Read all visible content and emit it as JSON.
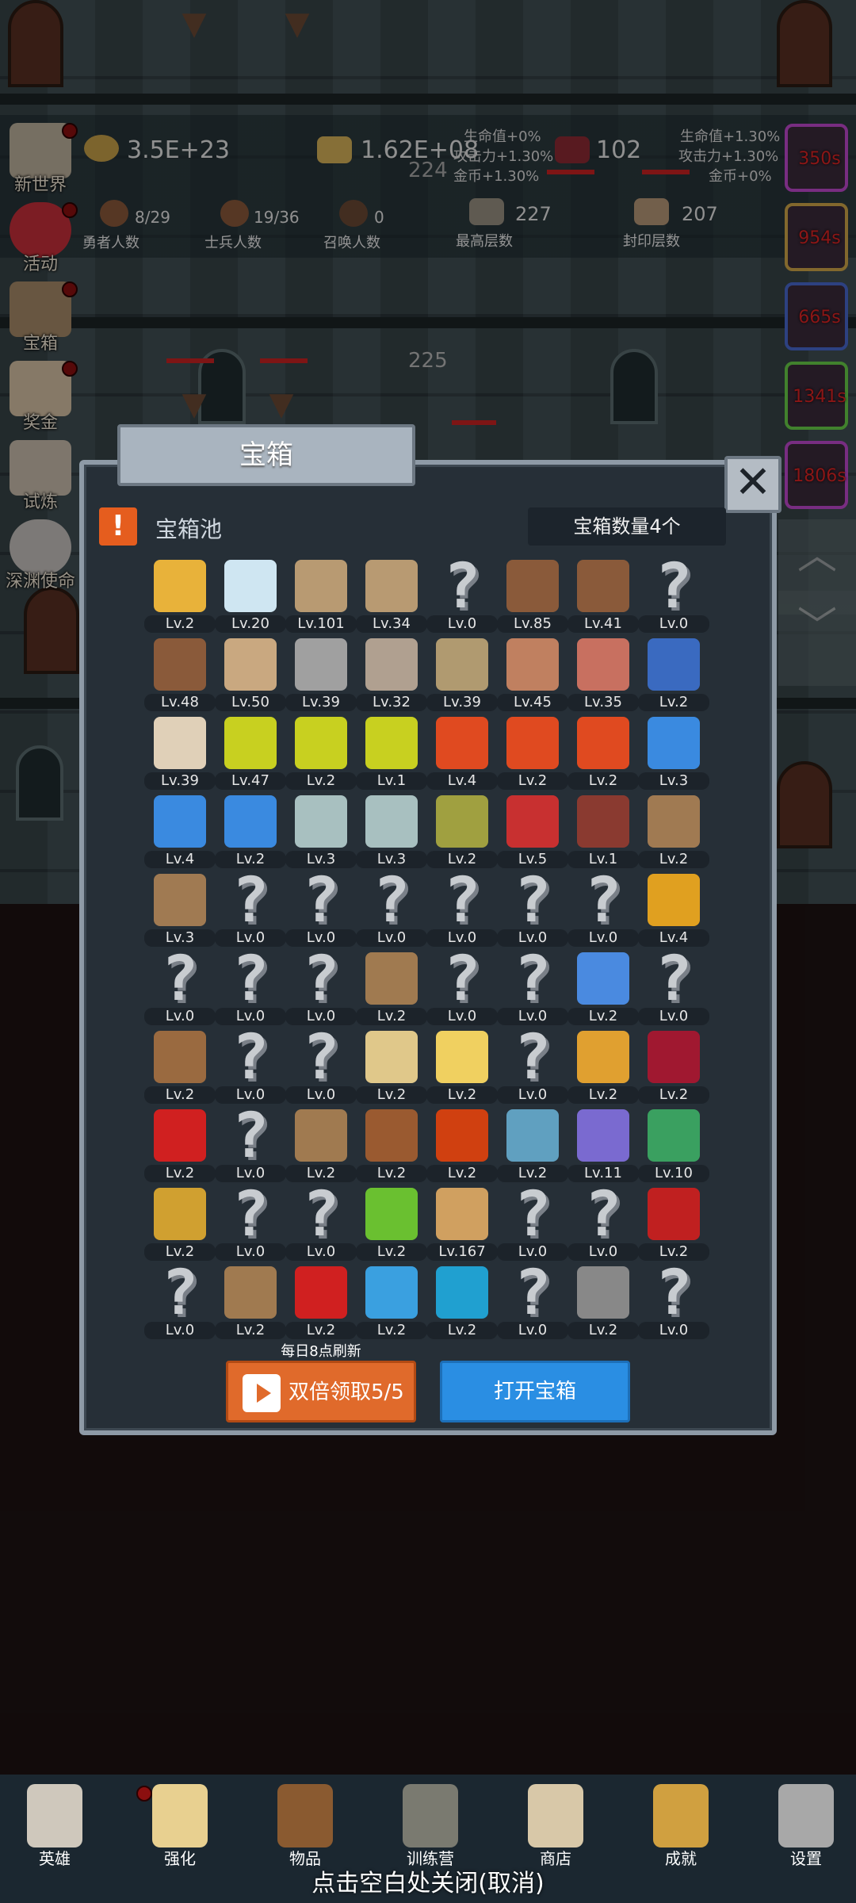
{
  "colors": {
    "accent_orange": "#e06a2b",
    "accent_blue": "#2a8ee3",
    "panel": "#262f37",
    "timer_red": "#e12424"
  },
  "top_stats": {
    "gold": "3.5E+23",
    "bars": "1.62E+08",
    "meat": "102",
    "damage_text": "224",
    "bonus_left": [
      "生命值+0%",
      "攻击力+1.30%",
      "金币+1.30%"
    ],
    "bonus_right": [
      "生命值+1.30%",
      "攻击力+1.30%",
      "金币+0%"
    ],
    "heroes": {
      "value": "8/29",
      "label": "勇者人数"
    },
    "soldiers": {
      "value": "19/36",
      "label": "士兵人数"
    },
    "summons": {
      "value": "0",
      "label": "召唤人数"
    },
    "max_floor": {
      "value": "227",
      "label": "最高层数"
    },
    "seal_floor": {
      "value": "207",
      "label": "封印层数"
    },
    "floor_number": "225"
  },
  "side_menu": [
    {
      "label": "新世界",
      "icon": "castle-icon"
    },
    {
      "label": "活动",
      "icon": "heart-icon"
    },
    {
      "label": "宝箱",
      "icon": "chest-icon"
    },
    {
      "label": "奖金",
      "icon": "letter-icon"
    },
    {
      "label": "试炼",
      "icon": "feather-icon"
    },
    {
      "label": "深渊使命",
      "icon": "orb-icon"
    }
  ],
  "right_timers": [
    "350s",
    "954s",
    "665s",
    "1341s",
    "1806s"
  ],
  "panel": {
    "title": "宝箱",
    "pool_label": "宝箱池",
    "count_label": "宝箱数量4个",
    "refresh_note": "每日8点刷新",
    "double_button": "双倍领取5/5",
    "open_button": "打开宝箱"
  },
  "items": [
    {
      "icon": "crown-icon",
      "lv": "Lv.2"
    },
    {
      "icon": "diamond-icon",
      "lv": "Lv.20"
    },
    {
      "icon": "sword-icon",
      "lv": "Lv.101"
    },
    {
      "icon": "sword-icon",
      "lv": "Lv.34"
    },
    {
      "icon": "unknown-icon",
      "lv": "Lv.0"
    },
    {
      "icon": "backpack-icon",
      "lv": "Lv.85"
    },
    {
      "icon": "backpack-icon",
      "lv": "Lv.41"
    },
    {
      "icon": "unknown-icon",
      "lv": "Lv.0"
    },
    {
      "icon": "hood-icon",
      "lv": "Lv.48"
    },
    {
      "icon": "dagger-icon",
      "lv": "Lv.50"
    },
    {
      "icon": "helmet-icon",
      "lv": "Lv.39"
    },
    {
      "icon": "hammer-icon",
      "lv": "Lv.32"
    },
    {
      "icon": "great-helm-icon",
      "lv": "Lv.39"
    },
    {
      "icon": "meat-icon",
      "lv": "Lv.45"
    },
    {
      "icon": "steak-icon",
      "lv": "Lv.35"
    },
    {
      "icon": "pouch-icon",
      "lv": "Lv.2"
    },
    {
      "icon": "bread-icon",
      "lv": "Lv.39"
    },
    {
      "icon": "potion-yellow-icon",
      "lv": "Lv.47"
    },
    {
      "icon": "potion-yellow-icon",
      "lv": "Lv.2"
    },
    {
      "icon": "potion-yellow-icon",
      "lv": "Lv.1"
    },
    {
      "icon": "potion-red-icon",
      "lv": "Lv.4"
    },
    {
      "icon": "potion-red-icon",
      "lv": "Lv.2"
    },
    {
      "icon": "potion-red-icon",
      "lv": "Lv.2"
    },
    {
      "icon": "potion-blue-icon",
      "lv": "Lv.3"
    },
    {
      "icon": "potion-blue-icon",
      "lv": "Lv.4"
    },
    {
      "icon": "potion-blue-icon",
      "lv": "Lv.2"
    },
    {
      "icon": "vial-icon",
      "lv": "Lv.3"
    },
    {
      "icon": "vial-icon",
      "lv": "Lv.3"
    },
    {
      "icon": "bottle-icon",
      "lv": "Lv.2"
    },
    {
      "icon": "bottle-red-icon",
      "lv": "Lv.5"
    },
    {
      "icon": "boot-winged-icon",
      "lv": "Lv.1"
    },
    {
      "icon": "boot-icon",
      "lv": "Lv.2"
    },
    {
      "icon": "boot-icon",
      "lv": "Lv.3"
    },
    {
      "icon": "unknown-icon",
      "lv": "Lv.0"
    },
    {
      "icon": "unknown-icon",
      "lv": "Lv.0"
    },
    {
      "icon": "unknown-icon",
      "lv": "Lv.0"
    },
    {
      "icon": "unknown-icon",
      "lv": "Lv.0"
    },
    {
      "icon": "unknown-icon",
      "lv": "Lv.0"
    },
    {
      "icon": "unknown-icon",
      "lv": "Lv.0"
    },
    {
      "icon": "torch-icon",
      "lv": "Lv.4"
    },
    {
      "icon": "unknown-icon",
      "lv": "Lv.0"
    },
    {
      "icon": "unknown-icon",
      "lv": "Lv.0"
    },
    {
      "icon": "unknown-icon",
      "lv": "Lv.0"
    },
    {
      "icon": "staff-icon",
      "lv": "Lv.2"
    },
    {
      "icon": "unknown-icon",
      "lv": "Lv.0"
    },
    {
      "icon": "unknown-icon",
      "lv": "Lv.0"
    },
    {
      "icon": "wand-blue-icon",
      "lv": "Lv.2"
    },
    {
      "icon": "unknown-icon",
      "lv": "Lv.0"
    },
    {
      "icon": "satchel-icon",
      "lv": "Lv.2"
    },
    {
      "icon": "unknown-icon",
      "lv": "Lv.0"
    },
    {
      "icon": "unknown-icon",
      "lv": "Lv.0"
    },
    {
      "icon": "club-icon",
      "lv": "Lv.2"
    },
    {
      "icon": "cheese-icon",
      "lv": "Lv.2"
    },
    {
      "icon": "unknown-icon",
      "lv": "Lv.0"
    },
    {
      "icon": "jar-icon",
      "lv": "Lv.2"
    },
    {
      "icon": "crystal-icon",
      "lv": "Lv.2"
    },
    {
      "icon": "red-orb-icon",
      "lv": "Lv.2"
    },
    {
      "icon": "unknown-icon",
      "lv": "Lv.0"
    },
    {
      "icon": "bow-icon",
      "lv": "Lv.2"
    },
    {
      "icon": "quiver-icon",
      "lv": "Lv.2"
    },
    {
      "icon": "fire-glove-icon",
      "lv": "Lv.2"
    },
    {
      "icon": "ice-armor-icon",
      "lv": "Lv.2"
    },
    {
      "icon": "spirit-icon",
      "lv": "Lv.11"
    },
    {
      "icon": "emerald-shield-icon",
      "lv": "Lv.10"
    },
    {
      "icon": "scepter-icon",
      "lv": "Lv.2"
    },
    {
      "icon": "unknown-icon",
      "lv": "Lv.0"
    },
    {
      "icon": "unknown-icon",
      "lv": "Lv.0"
    },
    {
      "icon": "green-wand-icon",
      "lv": "Lv.2"
    },
    {
      "icon": "beer-icon",
      "lv": "Lv.167"
    },
    {
      "icon": "unknown-icon",
      "lv": "Lv.0"
    },
    {
      "icon": "unknown-icon",
      "lv": "Lv.0"
    },
    {
      "icon": "red-book-icon",
      "lv": "Lv.2"
    },
    {
      "icon": "unknown-icon",
      "lv": "Lv.0"
    },
    {
      "icon": "whip-icon",
      "lv": "Lv.2"
    },
    {
      "icon": "banner-icon",
      "lv": "Lv.2"
    },
    {
      "icon": "blue-orb-stand-icon",
      "lv": "Lv.2"
    },
    {
      "icon": "rune-orb-icon",
      "lv": "Lv.2"
    },
    {
      "icon": "unknown-icon",
      "lv": "Lv.0"
    },
    {
      "icon": "fire-staff-icon",
      "lv": "Lv.2"
    },
    {
      "icon": "unknown-icon",
      "lv": "Lv.0"
    }
  ],
  "bottom_nav": [
    {
      "label": "英雄",
      "icon": "skull-icon"
    },
    {
      "label": "强化",
      "icon": "candle-icon"
    },
    {
      "label": "物品",
      "icon": "book-icon"
    },
    {
      "label": "训练营",
      "icon": "lantern-icon"
    },
    {
      "label": "商店",
      "icon": "tankard-icon"
    },
    {
      "label": "成就",
      "icon": "key-icon"
    },
    {
      "label": "设置",
      "icon": "gear-icon"
    }
  ],
  "close_hint": "点击空白处关闭(取消)"
}
